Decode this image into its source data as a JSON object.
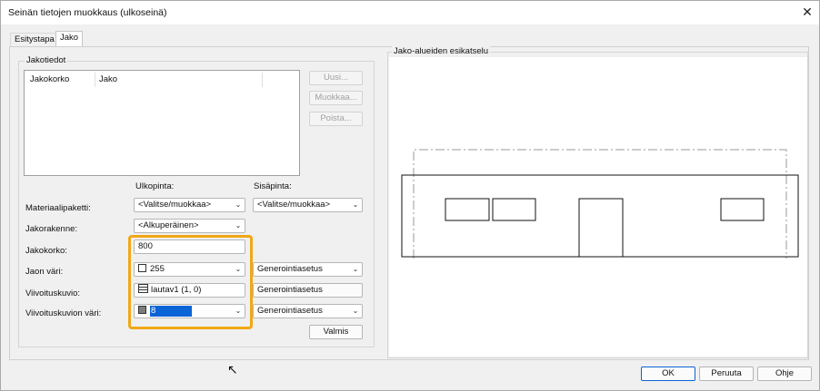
{
  "window": {
    "title": "Seinän tietojen muokkaus (ulkoseinä)",
    "close_glyph": "✕"
  },
  "tabs": [
    {
      "label": "Esitystapa"
    },
    {
      "label": "Jako"
    }
  ],
  "jakotiedot": {
    "group_label": "Jakotiedot",
    "columns": [
      "Jakokorko",
      "Jako"
    ],
    "buttons": {
      "new": "Uusi...",
      "edit": "Muokkaa...",
      "delete": "Poista..."
    }
  },
  "form": {
    "ulkopinta_label": "Ulkopinta:",
    "sisapinta_label": "Sisäpinta:",
    "materiaalipaketti": {
      "label": "Materiaalipaketti:",
      "outer": "<Valitse/muokkaa>",
      "inner": "<Valitse/muokkaa>"
    },
    "jakorakenne": {
      "label": "Jakorakenne:",
      "value": "<Alkuperäinen>"
    },
    "jakokorko": {
      "label": "Jakokorko:",
      "value": "800"
    },
    "jaon_vari": {
      "label": "Jaon väri:",
      "value": "255",
      "setting": "Generointiasetus"
    },
    "viivoituskuvio": {
      "label": "Viivoituskuvio:",
      "value": "lautav1 (1, 0)",
      "setting": "Generointiasetus"
    },
    "viivoituskuvion_vari": {
      "label": "Viivoituskuvion väri:",
      "value": "8",
      "setting": "Generointiasetus"
    },
    "valmis": "Valmis"
  },
  "preview": {
    "label": "Jako-alueiden esikatselu"
  },
  "footer": {
    "ok": "OK",
    "cancel": "Peruuta",
    "help": "Ohje"
  },
  "colors": {
    "highlight": "#f0a817",
    "selection": "#0a64d6"
  }
}
